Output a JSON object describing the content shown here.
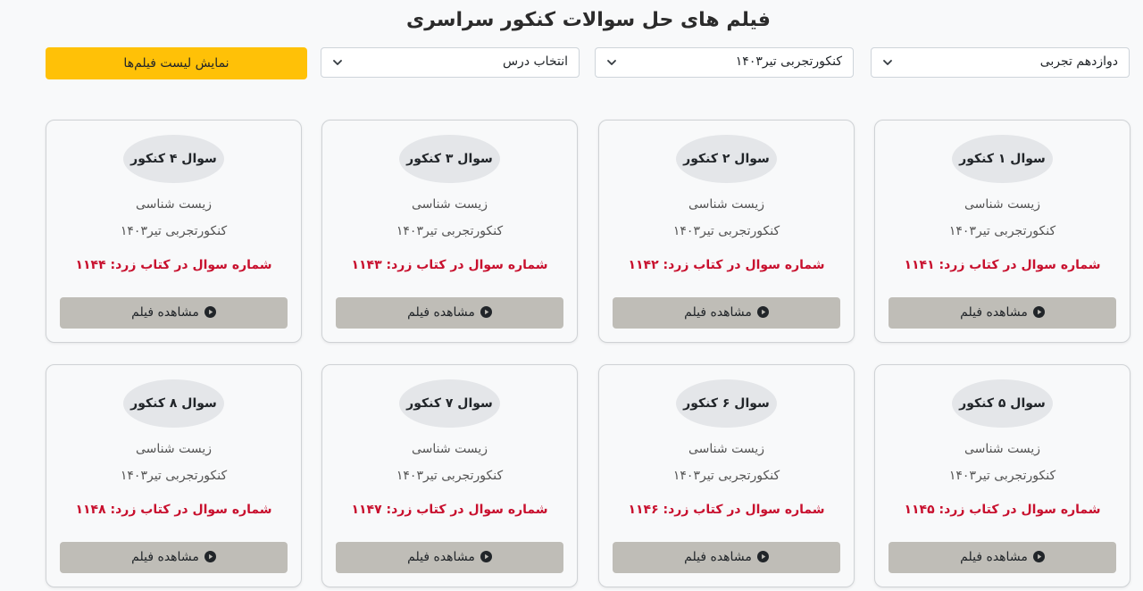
{
  "page": {
    "title": "فیلم های حل سوالات کنکور سراسری"
  },
  "filters": {
    "grade": "دوازدهم تجربی",
    "exam": "کنکورتجربی تیر۱۴۰۳",
    "lesson": "انتخاب درس",
    "show_button": "نمایش لیست فیلم‌ها"
  },
  "cards": [
    {
      "title": "سوال ۱ کنکور",
      "subject": "زیست شناسی",
      "exam": "کنکورتجربی تیر۱۴۰۳",
      "book_ref": "شماره سوال در کتاب زرد: ۱۱۴۱",
      "button": "مشاهده فیلم"
    },
    {
      "title": "سوال ۲ کنکور",
      "subject": "زیست شناسی",
      "exam": "کنکورتجربی تیر۱۴۰۳",
      "book_ref": "شماره سوال در کتاب زرد: ۱۱۴۲",
      "button": "مشاهده فیلم"
    },
    {
      "title": "سوال ۳ کنکور",
      "subject": "زیست شناسی",
      "exam": "کنکورتجربی تیر۱۴۰۳",
      "book_ref": "شماره سوال در کتاب زرد: ۱۱۴۳",
      "button": "مشاهده فیلم"
    },
    {
      "title": "سوال ۴ کنکور",
      "subject": "زیست شناسی",
      "exam": "کنکورتجربی تیر۱۴۰۳",
      "book_ref": "شماره سوال در کتاب زرد: ۱۱۴۴",
      "button": "مشاهده فیلم"
    },
    {
      "title": "سوال ۵ کنکور",
      "subject": "زیست شناسی",
      "exam": "کنکورتجربی تیر۱۴۰۳",
      "book_ref": "شماره سوال در کتاب زرد: ۱۱۴۵",
      "button": "مشاهده فیلم"
    },
    {
      "title": "سوال ۶ کنکور",
      "subject": "زیست شناسی",
      "exam": "کنکورتجربی تیر۱۴۰۳",
      "book_ref": "شماره سوال در کتاب زرد: ۱۱۴۶",
      "button": "مشاهده فیلم"
    },
    {
      "title": "سوال ۷ کنکور",
      "subject": "زیست شناسی",
      "exam": "کنکورتجربی تیر۱۴۰۳",
      "book_ref": "شماره سوال در کتاب زرد: ۱۱۴۷",
      "button": "مشاهده فیلم"
    },
    {
      "title": "سوال ۸ کنکور",
      "subject": "زیست شناسی",
      "exam": "کنکورتجربی تیر۱۴۰۳",
      "book_ref": "شماره سوال در کتاب زرد: ۱۱۴۸",
      "button": "مشاهده فیلم"
    }
  ],
  "colors": {
    "accent": "#ffc107",
    "book_ref": "#c8102e",
    "watch_button": "#bfbdb7"
  },
  "icons": {
    "select_chevron": "chevron-down-icon",
    "watch": "play-circle-icon"
  }
}
